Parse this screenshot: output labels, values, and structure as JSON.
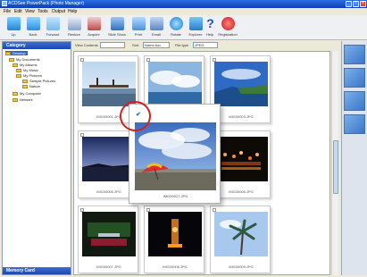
{
  "window": {
    "title": "ACDSee PowerPack (Photo Manager)"
  },
  "menu": [
    "File",
    "Edit",
    "View",
    "Tools",
    "Output",
    "Help"
  ],
  "toolbar": [
    {
      "label": "Up",
      "icon": "up-folder-icon"
    },
    {
      "label": "Back",
      "icon": "back-arrow-icon"
    },
    {
      "label": "Forward",
      "icon": "forward-arrow-icon"
    },
    {
      "label": "Restore",
      "icon": "restore-icon"
    },
    {
      "label": "Acquire",
      "icon": "acquire-icon"
    },
    {
      "label": "Slide Show",
      "icon": "slideshow-icon"
    },
    {
      "label": "Print",
      "icon": "print-icon"
    },
    {
      "label": "Email",
      "icon": "email-icon"
    },
    {
      "label": "Rotate",
      "icon": "rotate-icon"
    },
    {
      "label": "Explorer",
      "icon": "explorer-icon"
    },
    {
      "label": "Help",
      "icon": "help-icon"
    },
    {
      "label": "Registration",
      "icon": "registration-icon"
    }
  ],
  "left_panel": {
    "header": "Category",
    "footer": "Memory Card",
    "tree": [
      "Desktop",
      "My Documents",
      "My Albums",
      "My Music",
      "My Pictures",
      "Sample Pictures",
      "Nature",
      "My Computer",
      "Network"
    ]
  },
  "filters": {
    "view_label": "View Contents",
    "sort_label": "Sort",
    "sort_value": "Name Asc",
    "type_label": "File type",
    "type_value": "JPEG"
  },
  "thumbnails": [
    {
      "caption": "IMG00001.JPG"
    },
    {
      "caption": "IMG00002.JPG"
    },
    {
      "caption": "IMG00003.JPG"
    },
    {
      "caption": "IMG00005.JPG"
    },
    {
      "caption": "IMG00006.JPG"
    },
    {
      "caption": "IMG00007.JPG"
    },
    {
      "caption": "IMG00008.JPG"
    },
    {
      "caption": "IMG00009.JPG"
    }
  ],
  "popup": {
    "caption": "IMG00017.JPG"
  },
  "colors": {
    "title_bar": "#0a3fb8",
    "panel_header": "#1c49b0",
    "callout": "#d32020",
    "check": "#1b6fd8"
  }
}
